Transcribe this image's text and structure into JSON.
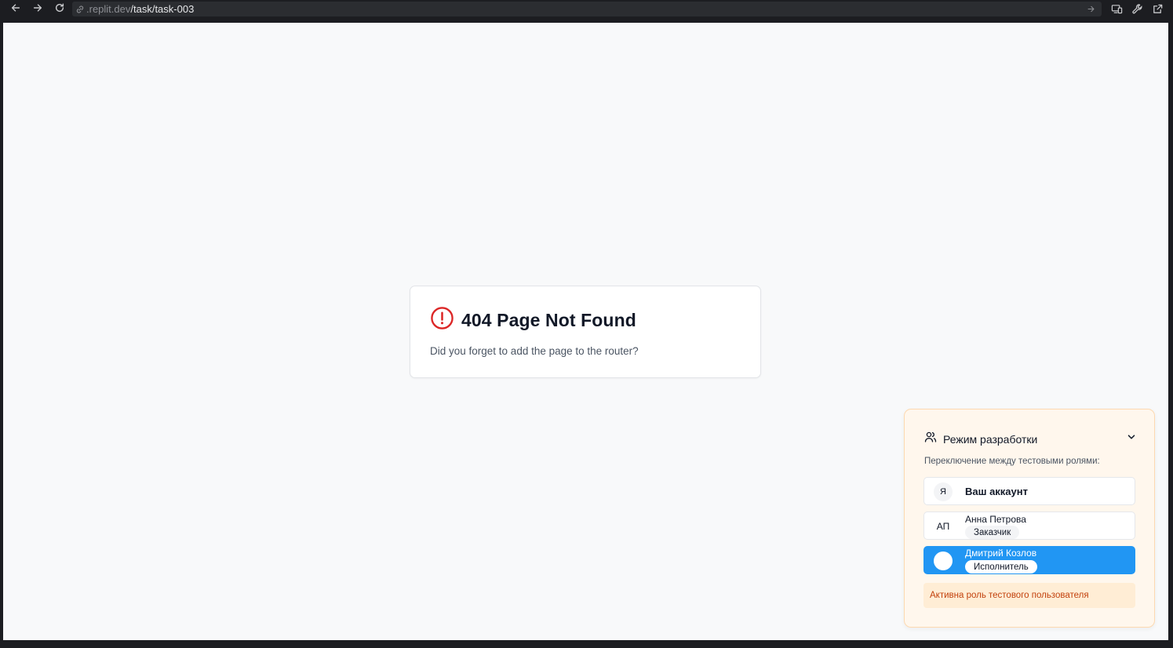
{
  "browser": {
    "url_domain": ".replit.dev",
    "url_path": "/task/task-003"
  },
  "not_found": {
    "title": "404 Page Not Found",
    "message": "Did you forget to add the page to the router?"
  },
  "dev_panel": {
    "title": "Режим разработки",
    "subtitle": "Переключение между тестовыми ролями:",
    "roles": [
      {
        "initials": "Я",
        "name": "Ваш аккаунт",
        "badge": "",
        "active": false
      },
      {
        "initials": "АП",
        "name": "Анна Петрова",
        "badge": "Заказчик",
        "active": false
      },
      {
        "initials": "",
        "name": "Дмитрий Козлов",
        "badge": "Исполнитель",
        "active": true
      }
    ],
    "notice": "Активна роль тестового пользователя"
  },
  "colors": {
    "accent": "#2196f3",
    "error": "#dc2626",
    "notice_text": "#c2410c"
  }
}
